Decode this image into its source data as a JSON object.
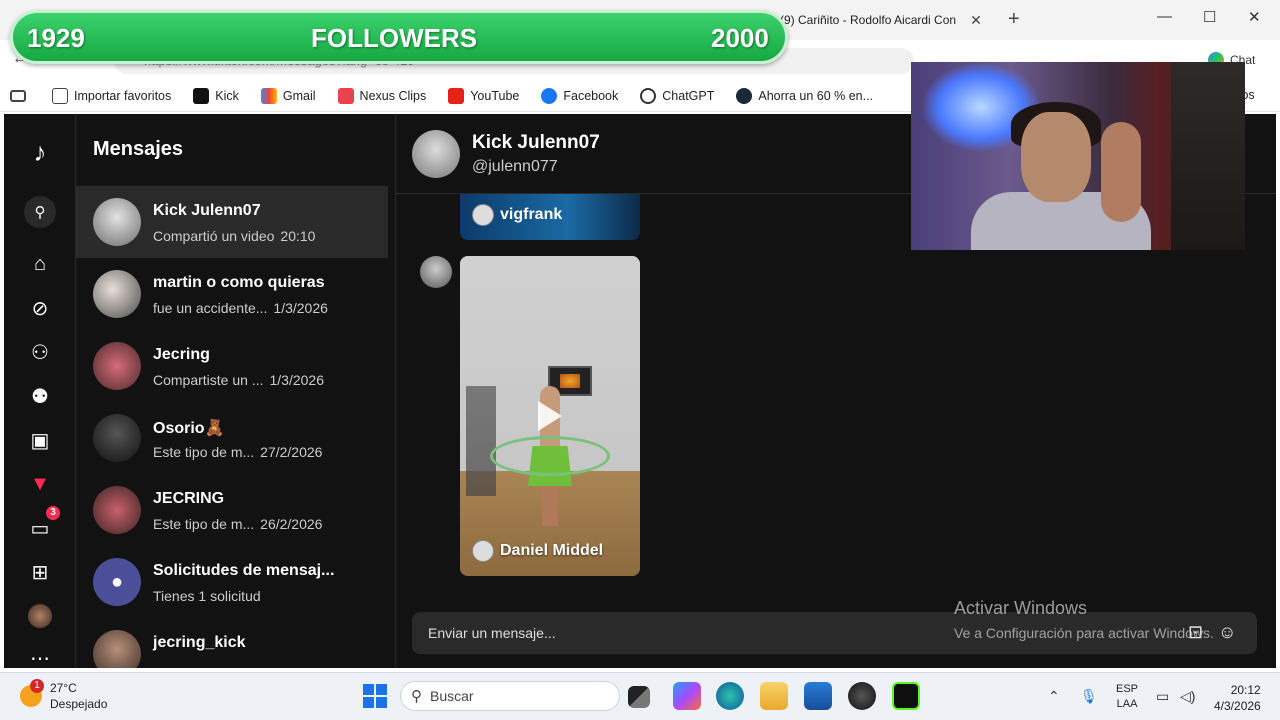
{
  "browser": {
    "active_tab_title": "(9) Cariñito - Rodolfo Aicardi Con",
    "url": "https://www.tiktok.com/messages?lang=es-419",
    "chat_label": "Chat",
    "bookmarks": [
      "Importar favoritos",
      "Kick",
      "Gmail",
      "Nexus Clips",
      "YouTube",
      "Facebook",
      "ChatGPT",
      "Ahorra un 60 % en...",
      "tos"
    ]
  },
  "overlay": {
    "current": "1929",
    "label": "FOLLOWERS",
    "goal": "2000"
  },
  "sidebar": {
    "messages_badge": "3"
  },
  "conversations": {
    "title": "Mensajes",
    "items": [
      {
        "name": "Kick Julenn07",
        "preview": "Compartió un video",
        "time": "20:10"
      },
      {
        "name": "martin o como quieras",
        "preview": "fue un accidente...",
        "time": "1/3/2026"
      },
      {
        "name": "Jecring",
        "preview": "Compartiste un ...",
        "time": "1/3/2026"
      },
      {
        "name": "Osorio🧸",
        "preview": "Este tipo de m...",
        "time": "27/2/2026"
      },
      {
        "name": "JECRING",
        "preview": "Este tipo de m...",
        "time": "26/2/2026"
      },
      {
        "name": "Solicitudes de mensaj...",
        "preview": "Tienes 1 solicitud",
        "time": ""
      },
      {
        "name": "jecring_kick",
        "preview": "",
        "time": ""
      }
    ]
  },
  "chat": {
    "name": "Kick Julenn07",
    "username": "@julenn077",
    "video_top_author": "vigfrank",
    "video_author": "Daniel Middel",
    "input_placeholder": "Enviar un mensaje..."
  },
  "watermark": {
    "line1": "Activar Windows",
    "line2": "Ve a Configuración para activar Windows."
  },
  "taskbar": {
    "weather_badge": "1",
    "temperature": "27°C",
    "condition": "Despejado",
    "search_placeholder": "Buscar",
    "lang_top": "ESP",
    "lang_bottom": "LAA",
    "time": "20:12",
    "date": "4/3/2026"
  }
}
